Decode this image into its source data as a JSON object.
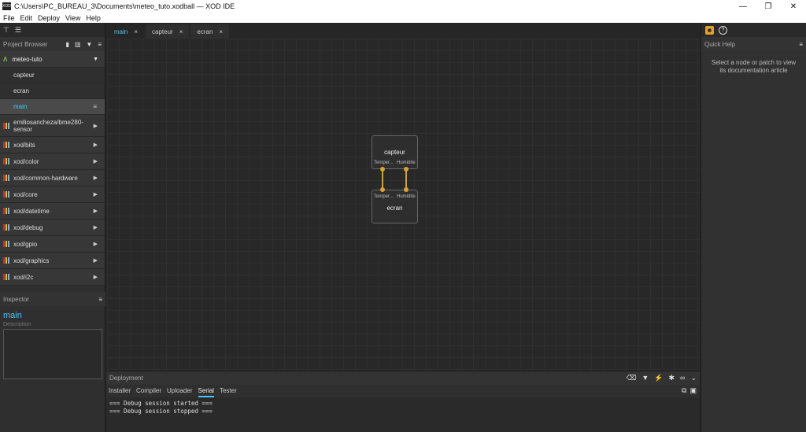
{
  "window": {
    "title": "C:\\Users\\PC_BUREAU_3\\Documents\\meteo_tuto.xodball — XOD IDE",
    "app_icon_text": "XOD",
    "minimize": "—",
    "restore": "❐",
    "close": "✕"
  },
  "menu": [
    "File",
    "Edit",
    "Deploy",
    "View",
    "Help"
  ],
  "project_browser": {
    "header": "Project Browser",
    "project": "meteo-tuto",
    "patches": [
      "capteur",
      "ecran",
      "main"
    ],
    "active_patch": "main",
    "libraries": [
      "emiliosancheza/bme280-sensor",
      "xod/bits",
      "xod/color",
      "xod/common-hardware",
      "xod/core",
      "xod/datetime",
      "xod/debug",
      "xod/gpio",
      "xod/graphics",
      "xod/i2c"
    ]
  },
  "inspector": {
    "header": "Inspector",
    "patch_name": "main",
    "description_label": "Description"
  },
  "tabs": [
    {
      "label": "main",
      "active": true
    },
    {
      "label": "capteur",
      "active": false
    },
    {
      "label": "ecran",
      "active": false
    }
  ],
  "nodes": {
    "capteur": {
      "label": "capteur",
      "pins": [
        "Temper...",
        "Humidite"
      ]
    },
    "ecran": {
      "label": "ecran",
      "pins": [
        "Temper...",
        "Humidite"
      ]
    }
  },
  "quick_help": {
    "header": "Quick Help",
    "text": "Select a node or patch to view its documentation article"
  },
  "deployment": {
    "header": "Deployment",
    "tabs": [
      "Installer",
      "Compiler",
      "Uploader",
      "Serial",
      "Tester"
    ],
    "active_tab": "Serial",
    "console_lines": [
      "=== Debug session started ===",
      "=== Debug session stopped ==="
    ]
  },
  "colors": {
    "accent": "#4fc3f7",
    "pin": "#e0a030",
    "link": "#c9a048"
  }
}
